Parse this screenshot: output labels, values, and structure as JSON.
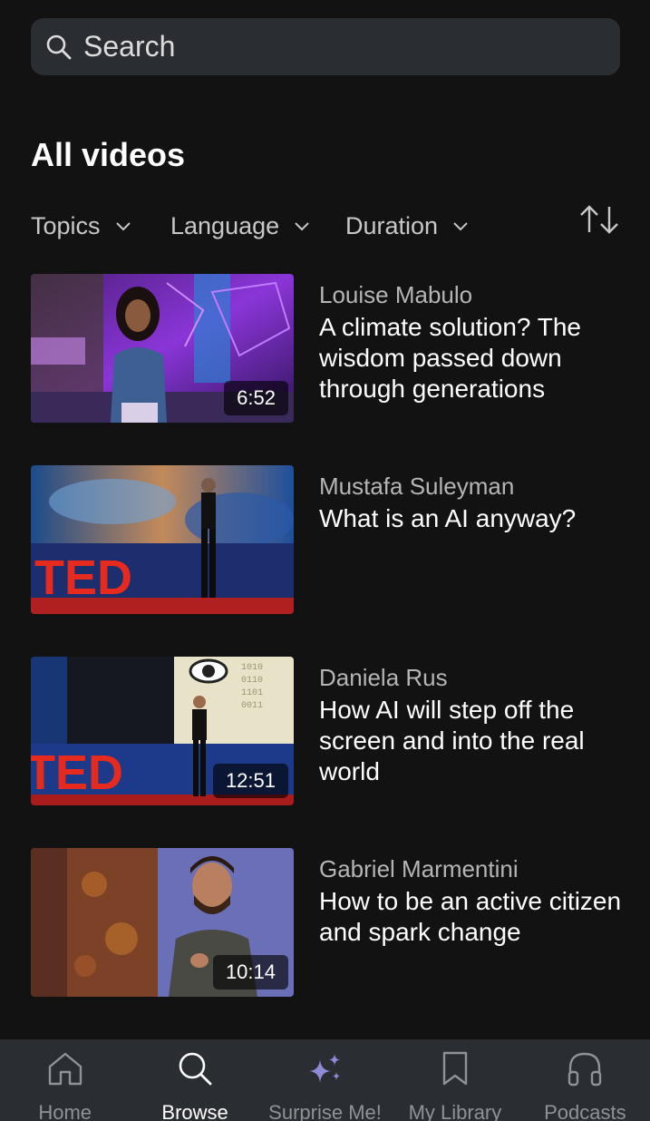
{
  "search": {
    "placeholder": "Search",
    "icon": "search-icon"
  },
  "section": {
    "title": "All videos"
  },
  "filters": {
    "items": [
      {
        "label": "Topics",
        "icon": "chevron-down-icon"
      },
      {
        "label": "Language",
        "icon": "chevron-down-icon"
      },
      {
        "label": "Duration",
        "icon": "chevron-down-icon"
      }
    ],
    "sort_icon": "sort-arrows-icon"
  },
  "videos": [
    {
      "speaker": "Louise Mabulo",
      "title": "A climate solution? The wisdom passed down through generations",
      "duration": "6:52"
    },
    {
      "speaker": "Mustafa Suleyman",
      "title": "What is an AI anyway?",
      "duration": ""
    },
    {
      "speaker": "Daniela Rus",
      "title": "How AI will step off the screen and into the real world",
      "duration": "12:51"
    },
    {
      "speaker": "Gabriel Marmentini",
      "title": "How to be an active citizen and spark change",
      "duration": "10:14"
    }
  ],
  "nav": {
    "items": [
      {
        "label": "Home",
        "icon": "home-icon"
      },
      {
        "label": "Browse",
        "icon": "search-icon"
      },
      {
        "label": "Surprise Me!",
        "icon": "sparkle-icon"
      },
      {
        "label": "My Library",
        "icon": "bookmark-icon"
      },
      {
        "label": "Podcasts",
        "icon": "headphones-icon"
      }
    ],
    "active": "Browse"
  },
  "colors": {
    "background": "#121212",
    "surface": "#2a2d31",
    "secondary_text": "#b5b5b5",
    "nav_inactive": "#8f9296",
    "sparkle_accent": "#8f8ad8",
    "ted_red": "#e62b1e"
  }
}
